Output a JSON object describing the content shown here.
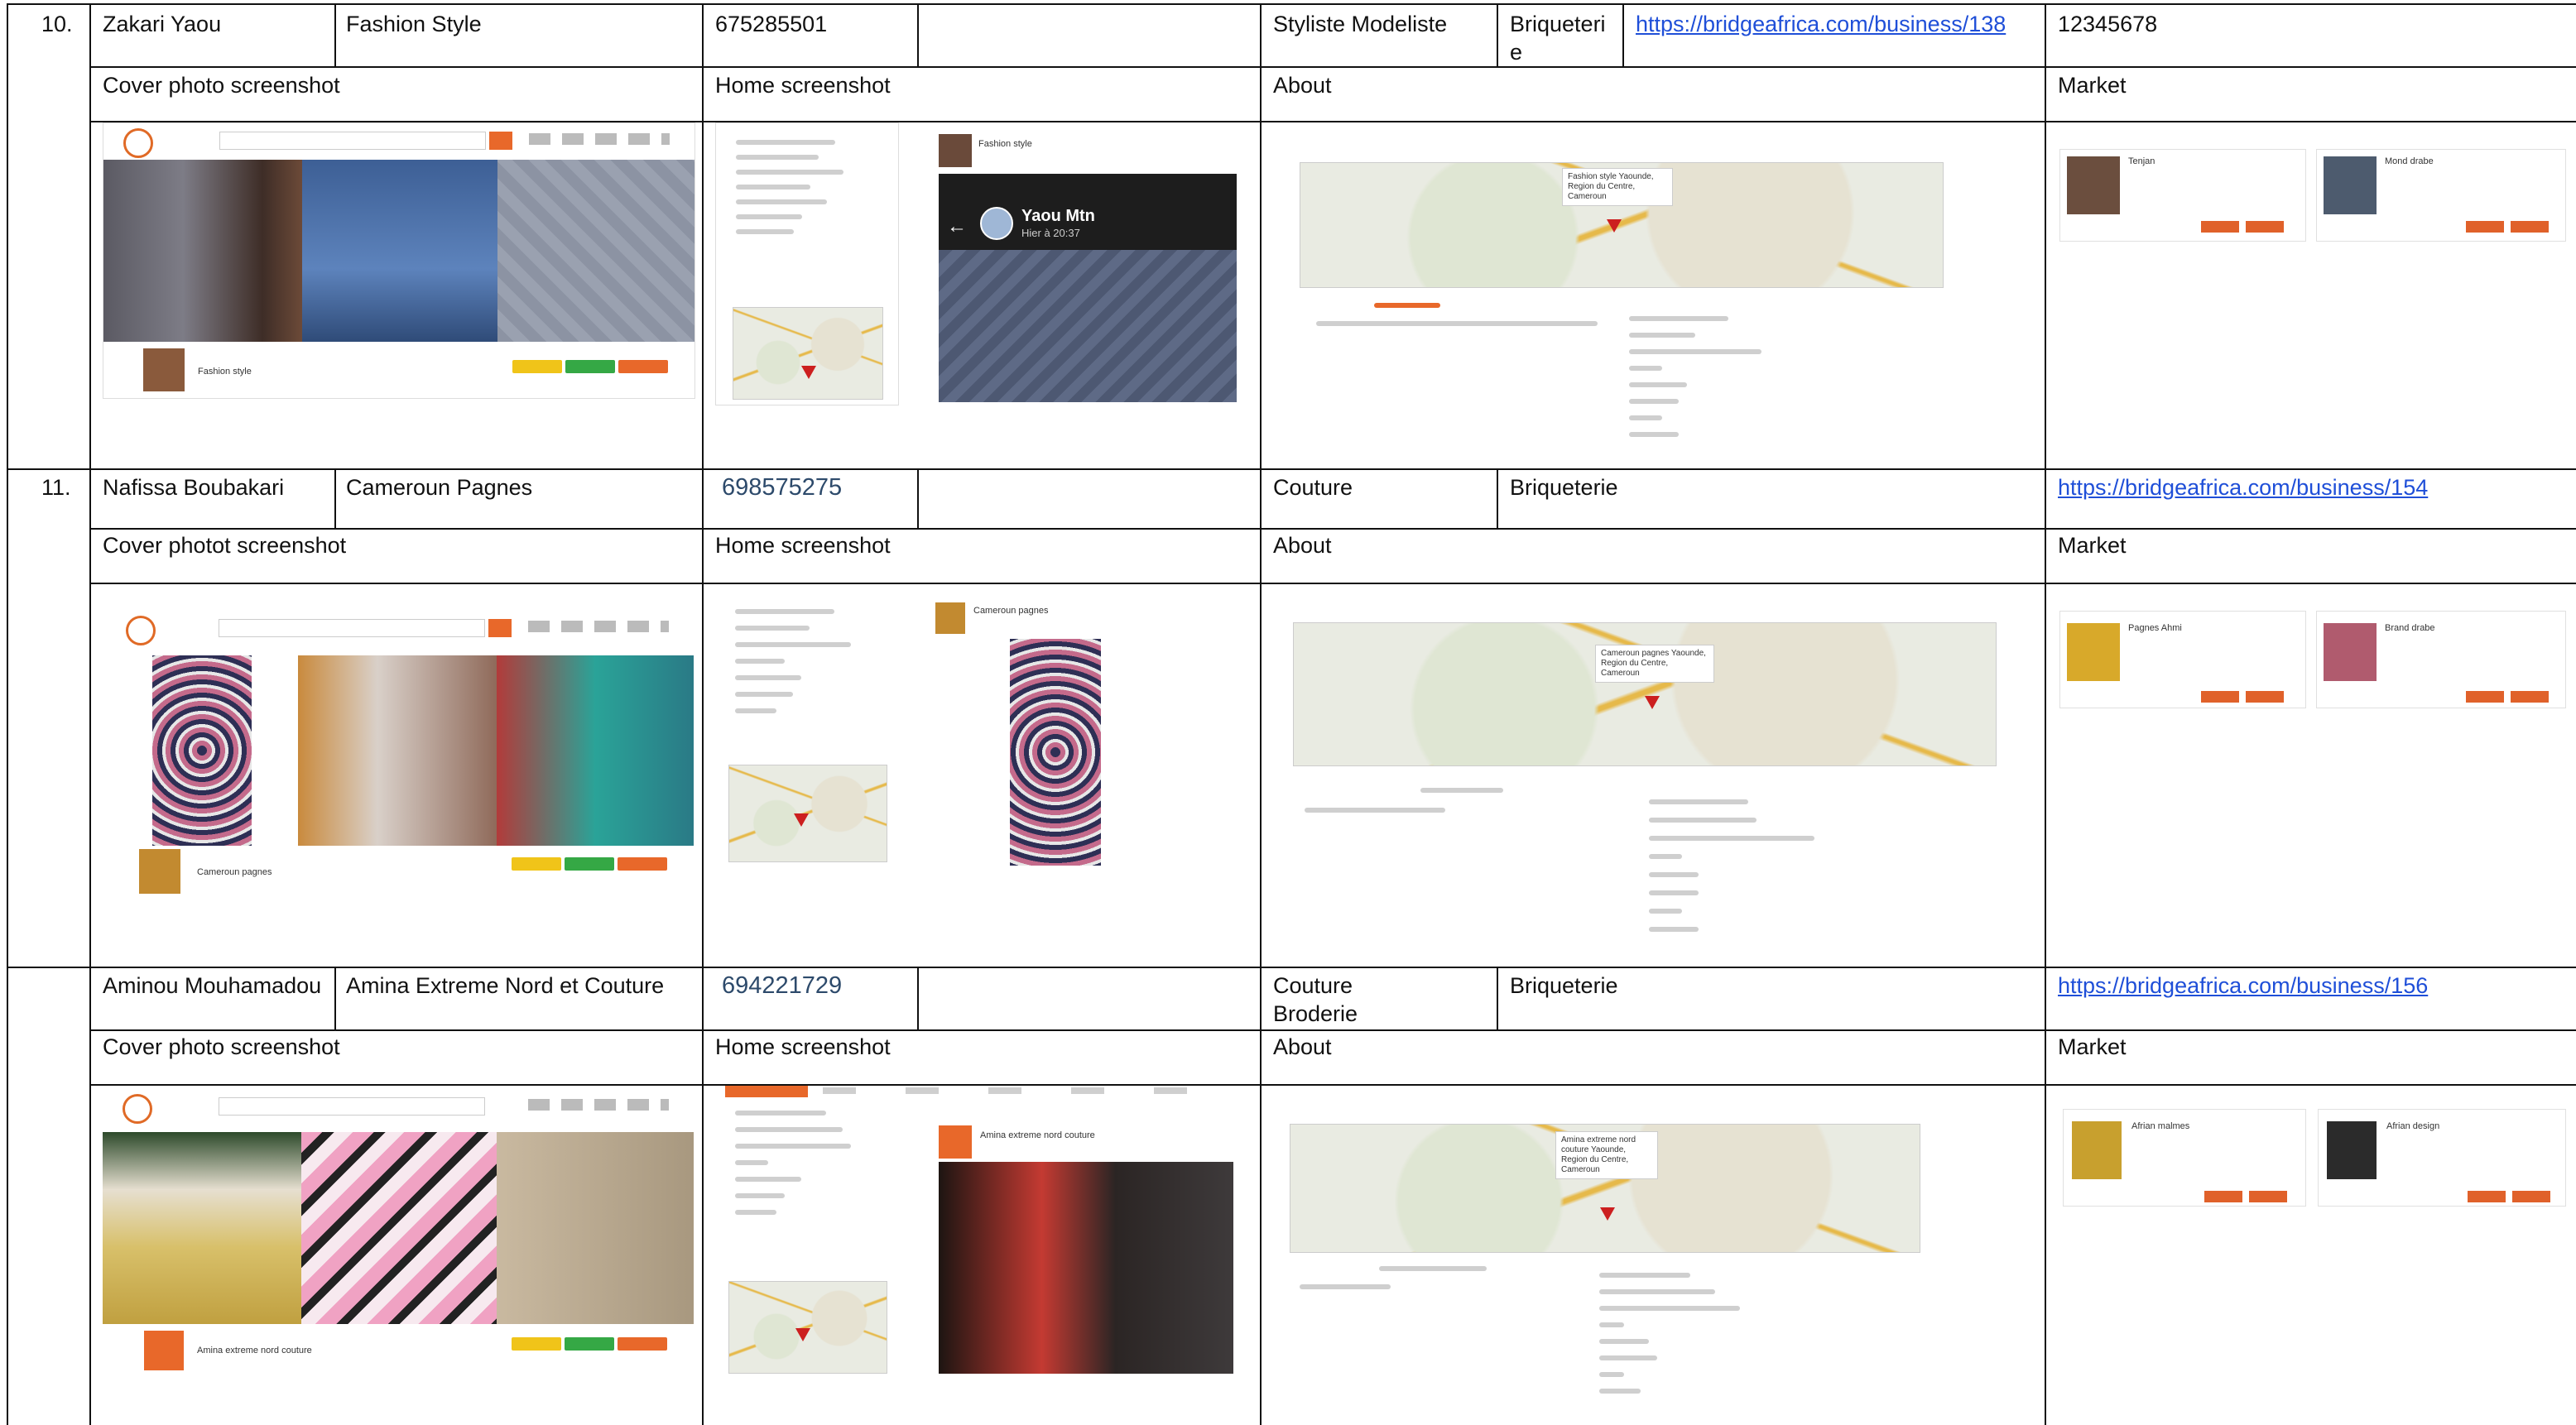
{
  "rows": [
    {
      "number": "10.",
      "name": "Zakari Yaou",
      "business": "Fashion Style",
      "phone": "675285501",
      "category": "Styliste Modeliste",
      "location": "Briqueterie",
      "url": "https://bridgeafrica.com/business/138",
      "extra": "12345678",
      "labels": {
        "cover": "Cover photo screenshot",
        "home": "Home screenshot",
        "about": "About",
        "market": "Market"
      },
      "cover_profile_name": "Fashion style",
      "home_post_name": "Fashion style",
      "status_name": "Yaou Mtn",
      "status_time": "Hier à 20:37",
      "map_popup": "Fashion style Yaounde, Region du Centre, Cameroun",
      "market_items": [
        "Tenjan",
        "Mond drabe"
      ]
    },
    {
      "number": "11.",
      "name": "Nafissa Boubakari",
      "business": "Cameroun Pagnes",
      "phone": "698575275",
      "category": "Couture",
      "location": "Briqueterie",
      "url": "https://bridgeafrica.com/business/154",
      "extra": "",
      "labels": {
        "cover": "Cover photot screenshot",
        "home": "Home screenshot",
        "about": "About",
        "market": "Market"
      },
      "cover_profile_name": "Cameroun pagnes",
      "home_post_name": "Cameroun pagnes",
      "map_popup": "Cameroun pagnes Yaounde, Region du Centre, Cameroun",
      "market_items": [
        "Pagnes Ahmi",
        "Brand drabe"
      ]
    },
    {
      "number": "",
      "name": "Aminou Mouhamadou",
      "business": "Amina Extreme Nord et Couture",
      "phone": "694221729",
      "category": "Couture Broderie",
      "location": "Briqueterie",
      "url": "https://bridgeafrica.com/business/156",
      "extra": "",
      "labels": {
        "cover": "Cover photo screenshot",
        "home": "Home screenshot",
        "about": "About",
        "market": "Market"
      },
      "cover_profile_name": "Amina extreme nord couture",
      "home_post_name": "Amina extreme nord couture",
      "map_popup": "Amina extreme nord couture Yaounde, Region du Centre, Cameroun",
      "market_items": [
        "Afrian malmes",
        "Afrian design"
      ]
    }
  ],
  "colors": {
    "accent": "#e8682a",
    "link": "#1f4fd8",
    "grid": "#111111",
    "pin": "#cc1f1f"
  }
}
